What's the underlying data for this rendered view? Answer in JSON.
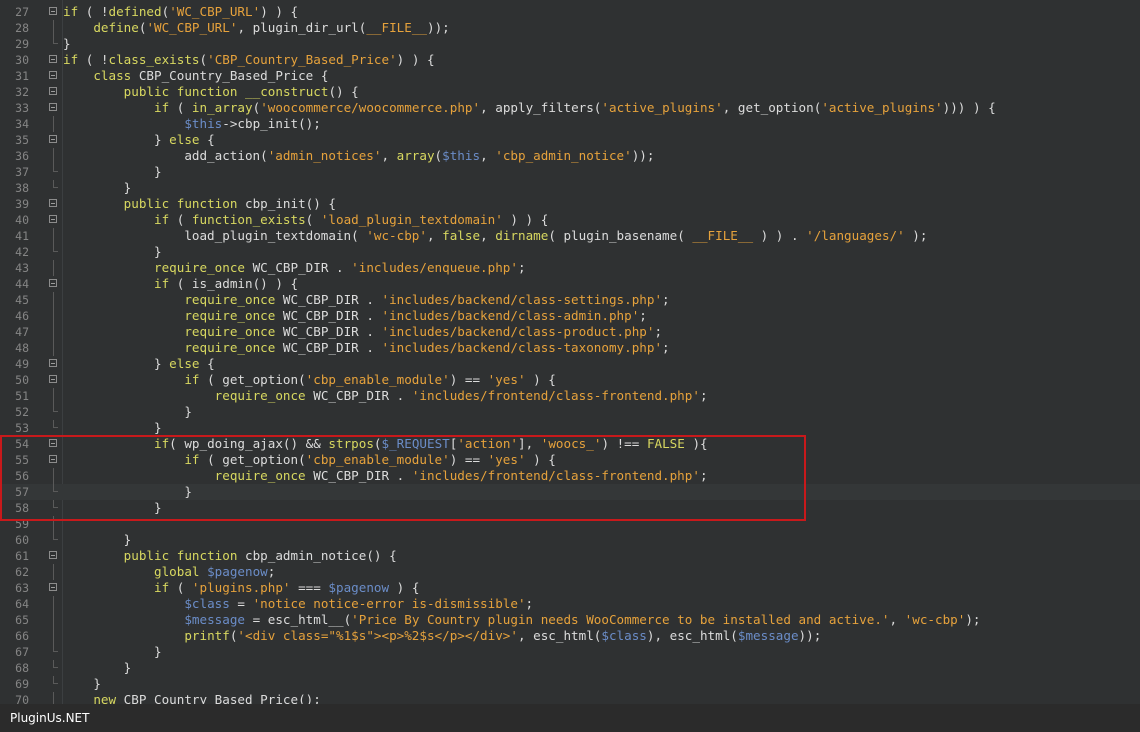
{
  "editor": {
    "lines": [
      {
        "num": "27",
        "fold": "start",
        "segs": [
          {
            "t": "if",
            "c": "kw"
          },
          {
            "t": " ( !"
          },
          {
            "t": "defined",
            "c": "fn"
          },
          {
            "t": "("
          },
          {
            "t": "'WC_CBP_URL'",
            "c": "str"
          },
          {
            "t": ") ) {"
          }
        ]
      },
      {
        "num": "28",
        "fold": "line",
        "segs": [
          {
            "t": "    "
          },
          {
            "t": "define",
            "c": "fn"
          },
          {
            "t": "("
          },
          {
            "t": "'WC_CBP_URL'",
            "c": "str"
          },
          {
            "t": ", plugin_dir_url("
          },
          {
            "t": "__FILE__",
            "c": "cst"
          },
          {
            "t": "));"
          }
        ]
      },
      {
        "num": "29",
        "fold": "end",
        "segs": [
          {
            "t": "}"
          }
        ]
      },
      {
        "num": "30",
        "fold": "start",
        "segs": [
          {
            "t": "if",
            "c": "kw"
          },
          {
            "t": " ( !"
          },
          {
            "t": "class_exists",
            "c": "fn"
          },
          {
            "t": "("
          },
          {
            "t": "'CBP_Country_Based_Price'",
            "c": "str"
          },
          {
            "t": ") ) {"
          }
        ]
      },
      {
        "num": "31",
        "fold": "start",
        "segs": [
          {
            "t": "    "
          },
          {
            "t": "class",
            "c": "kw"
          },
          {
            "t": " CBP_Country_Based_Price {"
          }
        ]
      },
      {
        "num": "32",
        "fold": "start",
        "segs": [
          {
            "t": "        "
          },
          {
            "t": "public",
            "c": "kw"
          },
          {
            "t": " "
          },
          {
            "t": "function",
            "c": "kw"
          },
          {
            "t": " "
          },
          {
            "t": "__construct",
            "c": "fn"
          },
          {
            "t": "() {"
          }
        ]
      },
      {
        "num": "33",
        "fold": "start",
        "segs": [
          {
            "t": "            "
          },
          {
            "t": "if",
            "c": "kw"
          },
          {
            "t": " ( "
          },
          {
            "t": "in_array",
            "c": "fn"
          },
          {
            "t": "("
          },
          {
            "t": "'woocommerce/woocommerce.php'",
            "c": "str"
          },
          {
            "t": ", apply_filters("
          },
          {
            "t": "'active_plugins'",
            "c": "str"
          },
          {
            "t": ", get_option("
          },
          {
            "t": "'active_plugins'",
            "c": "str"
          },
          {
            "t": "))) ) {"
          }
        ]
      },
      {
        "num": "34",
        "fold": "line",
        "segs": [
          {
            "t": "                "
          },
          {
            "t": "$this",
            "c": "var"
          },
          {
            "t": "->cbp_init();"
          }
        ]
      },
      {
        "num": "35",
        "fold": "start",
        "segs": [
          {
            "t": "            } "
          },
          {
            "t": "else",
            "c": "kw"
          },
          {
            "t": " {"
          }
        ]
      },
      {
        "num": "36",
        "fold": "line",
        "segs": [
          {
            "t": "                add_action("
          },
          {
            "t": "'admin_notices'",
            "c": "str"
          },
          {
            "t": ", "
          },
          {
            "t": "array",
            "c": "kw"
          },
          {
            "t": "("
          },
          {
            "t": "$this",
            "c": "var"
          },
          {
            "t": ", "
          },
          {
            "t": "'cbp_admin_notice'",
            "c": "str"
          },
          {
            "t": "));"
          }
        ]
      },
      {
        "num": "37",
        "fold": "end",
        "segs": [
          {
            "t": "            }"
          }
        ]
      },
      {
        "num": "38",
        "fold": "end",
        "segs": [
          {
            "t": "        }"
          }
        ]
      },
      {
        "num": "39",
        "fold": "start",
        "segs": [
          {
            "t": "        "
          },
          {
            "t": "public",
            "c": "kw"
          },
          {
            "t": " "
          },
          {
            "t": "function",
            "c": "kw"
          },
          {
            "t": " cbp_init() {"
          }
        ]
      },
      {
        "num": "40",
        "fold": "start",
        "segs": [
          {
            "t": "            "
          },
          {
            "t": "if",
            "c": "kw"
          },
          {
            "t": " ( "
          },
          {
            "t": "function_exists",
            "c": "fn"
          },
          {
            "t": "( "
          },
          {
            "t": "'load_plugin_textdomain'",
            "c": "str"
          },
          {
            "t": " ) ) {"
          }
        ]
      },
      {
        "num": "41",
        "fold": "line",
        "segs": [
          {
            "t": "                load_plugin_textdomain( "
          },
          {
            "t": "'wc-cbp'",
            "c": "str"
          },
          {
            "t": ", "
          },
          {
            "t": "false",
            "c": "kw"
          },
          {
            "t": ", "
          },
          {
            "t": "dirname",
            "c": "fn"
          },
          {
            "t": "( plugin_basename( "
          },
          {
            "t": "__FILE__",
            "c": "cst"
          },
          {
            "t": " ) ) . "
          },
          {
            "t": "'/languages/'",
            "c": "str"
          },
          {
            "t": " );"
          }
        ]
      },
      {
        "num": "42",
        "fold": "end",
        "segs": [
          {
            "t": "            }"
          }
        ]
      },
      {
        "num": "43",
        "fold": "line",
        "segs": [
          {
            "t": "            "
          },
          {
            "t": "require_once",
            "c": "kw"
          },
          {
            "t": " WC_CBP_DIR . "
          },
          {
            "t": "'includes/enqueue.php'",
            "c": "str"
          },
          {
            "t": ";"
          }
        ]
      },
      {
        "num": "44",
        "fold": "start",
        "segs": [
          {
            "t": "            "
          },
          {
            "t": "if",
            "c": "kw"
          },
          {
            "t": " ( is_admin() ) {"
          }
        ]
      },
      {
        "num": "45",
        "fold": "line",
        "segs": [
          {
            "t": "                "
          },
          {
            "t": "require_once",
            "c": "kw"
          },
          {
            "t": " WC_CBP_DIR . "
          },
          {
            "t": "'includes/backend/class-settings.php'",
            "c": "str"
          },
          {
            "t": ";"
          }
        ]
      },
      {
        "num": "46",
        "fold": "line",
        "segs": [
          {
            "t": "                "
          },
          {
            "t": "require_once",
            "c": "kw"
          },
          {
            "t": " WC_CBP_DIR . "
          },
          {
            "t": "'includes/backend/class-admin.php'",
            "c": "str"
          },
          {
            "t": ";"
          }
        ]
      },
      {
        "num": "47",
        "fold": "line",
        "segs": [
          {
            "t": "                "
          },
          {
            "t": "require_once",
            "c": "kw"
          },
          {
            "t": " WC_CBP_DIR . "
          },
          {
            "t": "'includes/backend/class-product.php'",
            "c": "str"
          },
          {
            "t": ";"
          }
        ]
      },
      {
        "num": "48",
        "fold": "line",
        "segs": [
          {
            "t": "                "
          },
          {
            "t": "require_once",
            "c": "kw"
          },
          {
            "t": " WC_CBP_DIR . "
          },
          {
            "t": "'includes/backend/class-taxonomy.php'",
            "c": "str"
          },
          {
            "t": ";"
          }
        ]
      },
      {
        "num": "49",
        "fold": "start",
        "segs": [
          {
            "t": "            } "
          },
          {
            "t": "else",
            "c": "kw"
          },
          {
            "t": " {"
          }
        ]
      },
      {
        "num": "50",
        "fold": "start",
        "segs": [
          {
            "t": "                "
          },
          {
            "t": "if",
            "c": "kw"
          },
          {
            "t": " ( get_option("
          },
          {
            "t": "'cbp_enable_module'",
            "c": "str"
          },
          {
            "t": ") == "
          },
          {
            "t": "'yes'",
            "c": "str"
          },
          {
            "t": " ) {"
          }
        ]
      },
      {
        "num": "51",
        "fold": "line",
        "segs": [
          {
            "t": "                    "
          },
          {
            "t": "require_once",
            "c": "kw"
          },
          {
            "t": " WC_CBP_DIR . "
          },
          {
            "t": "'includes/frontend/class-frontend.php'",
            "c": "str"
          },
          {
            "t": ";"
          }
        ]
      },
      {
        "num": "52",
        "fold": "end",
        "segs": [
          {
            "t": "                }"
          }
        ]
      },
      {
        "num": "53",
        "fold": "end",
        "segs": [
          {
            "t": "            }"
          }
        ]
      },
      {
        "num": "54",
        "fold": "start",
        "segs": [
          {
            "t": "            "
          },
          {
            "t": "if",
            "c": "kw"
          },
          {
            "t": "( wp_doing_ajax() && "
          },
          {
            "t": "strpos",
            "c": "fn"
          },
          {
            "t": "("
          },
          {
            "t": "$_REQUEST",
            "c": "var"
          },
          {
            "t": "["
          },
          {
            "t": "'action'",
            "c": "str"
          },
          {
            "t": "], "
          },
          {
            "t": "'woocs_'",
            "c": "str"
          },
          {
            "t": ") !== "
          },
          {
            "t": "FALSE",
            "c": "kw"
          },
          {
            "t": " ){"
          }
        ]
      },
      {
        "num": "55",
        "fold": "start",
        "segs": [
          {
            "t": "                "
          },
          {
            "t": "if",
            "c": "kw"
          },
          {
            "t": " ( get_option("
          },
          {
            "t": "'cbp_enable_module'",
            "c": "str"
          },
          {
            "t": ") == "
          },
          {
            "t": "'yes'",
            "c": "str"
          },
          {
            "t": " ) {"
          }
        ]
      },
      {
        "num": "56",
        "fold": "line",
        "segs": [
          {
            "t": "                    "
          },
          {
            "t": "require_once",
            "c": "kw"
          },
          {
            "t": " WC_CBP_DIR . "
          },
          {
            "t": "'includes/frontend/class-frontend.php'",
            "c": "str"
          },
          {
            "t": ";"
          }
        ]
      },
      {
        "num": "57",
        "fold": "end",
        "current": true,
        "segs": [
          {
            "t": "                }"
          }
        ]
      },
      {
        "num": "58",
        "fold": "end",
        "segs": [
          {
            "t": "            }"
          }
        ]
      },
      {
        "num": "59",
        "fold": "line",
        "segs": []
      },
      {
        "num": "60",
        "fold": "end",
        "segs": [
          {
            "t": "        }"
          }
        ]
      },
      {
        "num": "61",
        "fold": "start",
        "segs": [
          {
            "t": "        "
          },
          {
            "t": "public",
            "c": "kw"
          },
          {
            "t": " "
          },
          {
            "t": "function",
            "c": "kw"
          },
          {
            "t": " cbp_admin_notice() {"
          }
        ]
      },
      {
        "num": "62",
        "fold": "line",
        "segs": [
          {
            "t": "            "
          },
          {
            "t": "global",
            "c": "kw"
          },
          {
            "t": " "
          },
          {
            "t": "$pagenow",
            "c": "var"
          },
          {
            "t": ";"
          }
        ]
      },
      {
        "num": "63",
        "fold": "start",
        "segs": [
          {
            "t": "            "
          },
          {
            "t": "if",
            "c": "kw"
          },
          {
            "t": " ( "
          },
          {
            "t": "'plugins.php'",
            "c": "str"
          },
          {
            "t": " === "
          },
          {
            "t": "$pagenow",
            "c": "var"
          },
          {
            "t": " ) {"
          }
        ]
      },
      {
        "num": "64",
        "fold": "line",
        "segs": [
          {
            "t": "                "
          },
          {
            "t": "$class",
            "c": "var"
          },
          {
            "t": " = "
          },
          {
            "t": "'notice notice-error is-dismissible'",
            "c": "str"
          },
          {
            "t": ";"
          }
        ]
      },
      {
        "num": "65",
        "fold": "line",
        "segs": [
          {
            "t": "                "
          },
          {
            "t": "$message",
            "c": "var"
          },
          {
            "t": " = esc_html__("
          },
          {
            "t": "'Price By Country plugin needs WooCommerce to be installed and active.'",
            "c": "str"
          },
          {
            "t": ", "
          },
          {
            "t": "'wc-cbp'",
            "c": "str"
          },
          {
            "t": ");"
          }
        ]
      },
      {
        "num": "66",
        "fold": "line",
        "segs": [
          {
            "t": "                "
          },
          {
            "t": "printf",
            "c": "kw"
          },
          {
            "t": "("
          },
          {
            "t": "'<div class=\"%1$s\"><p>%2$s</p></div>'",
            "c": "str"
          },
          {
            "t": ", esc_html("
          },
          {
            "t": "$class",
            "c": "var"
          },
          {
            "t": "), esc_html("
          },
          {
            "t": "$message",
            "c": "var"
          },
          {
            "t": "));"
          }
        ]
      },
      {
        "num": "67",
        "fold": "end",
        "segs": [
          {
            "t": "            }"
          }
        ]
      },
      {
        "num": "68",
        "fold": "end",
        "segs": [
          {
            "t": "        }"
          }
        ]
      },
      {
        "num": "69",
        "fold": "end",
        "segs": [
          {
            "t": "    }"
          }
        ]
      },
      {
        "num": "70",
        "fold": "line",
        "segs": [
          {
            "t": "    "
          },
          {
            "t": "new",
            "c": "kw"
          },
          {
            "t": " CBP_Country_Based_Price();"
          }
        ]
      }
    ]
  },
  "watermark": "PluginUs.NET",
  "colors": {
    "keyword": "#d8d860",
    "string": "#e6a23c",
    "variable": "#6b8dc8",
    "highlight_box": "#c8191b"
  }
}
